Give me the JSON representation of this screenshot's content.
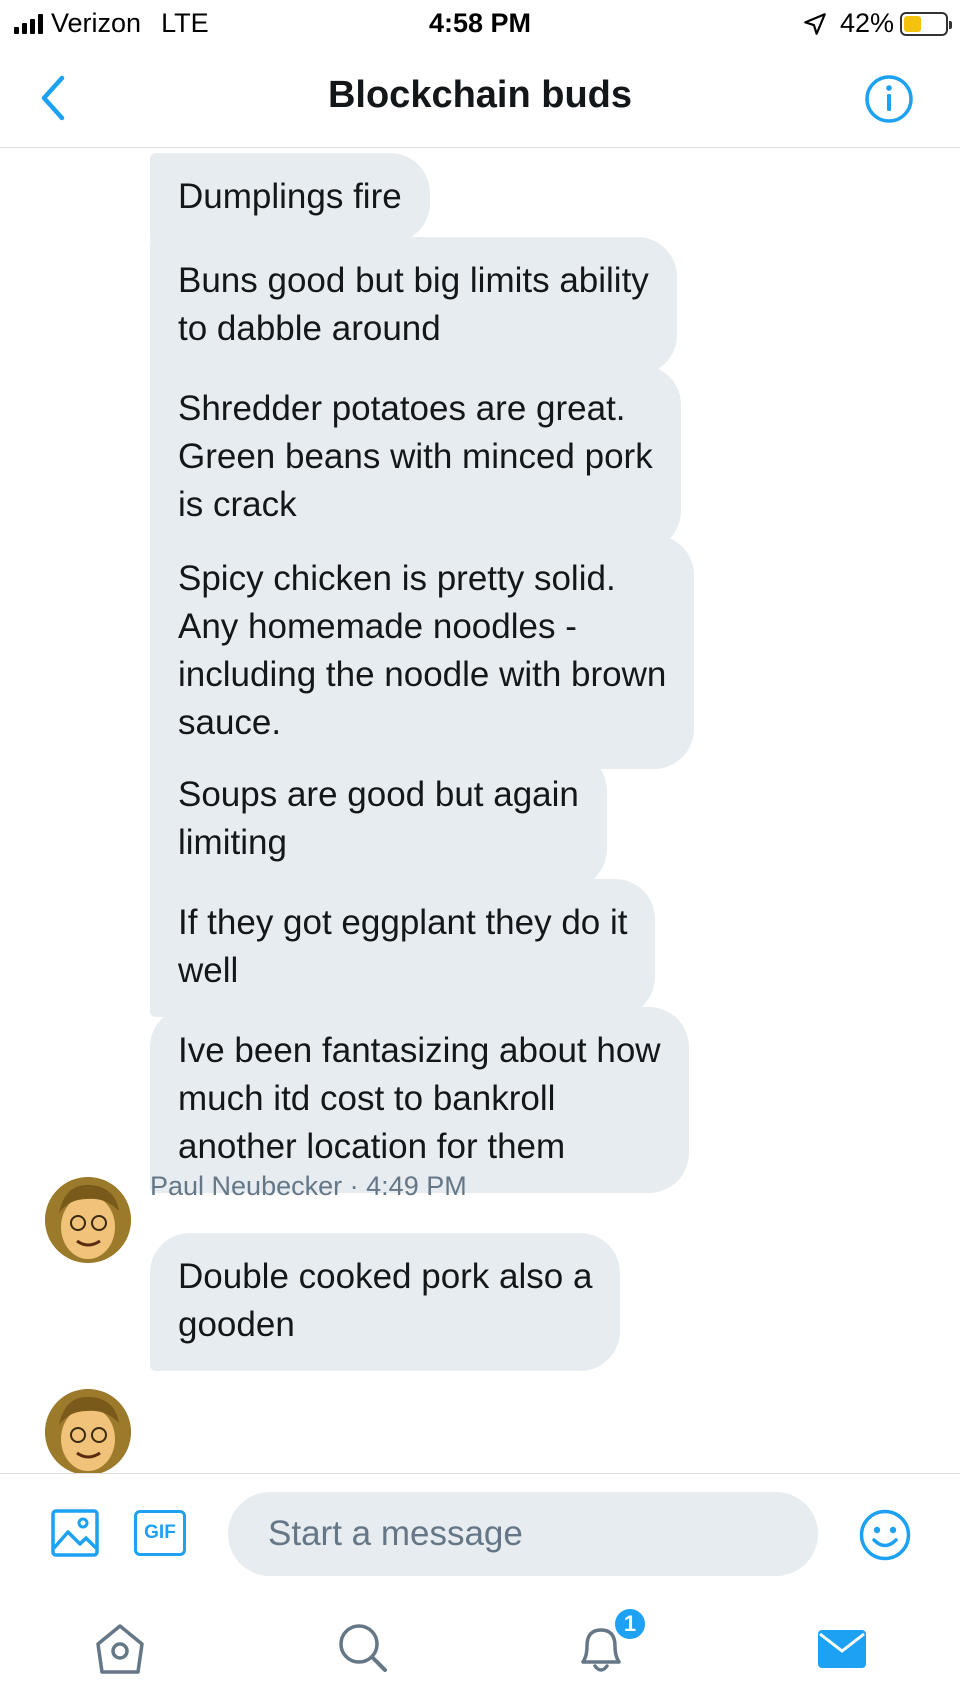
{
  "status_bar": {
    "carrier": "Verizon",
    "network": "LTE",
    "time": "4:58 PM",
    "battery": "42%",
    "battery_level": 0.42,
    "battery_color": "#f4c20d"
  },
  "header": {
    "title": "Blockchain buds",
    "back_icon": "chevron-left-icon",
    "info_icon": "info-icon"
  },
  "messages": [
    {
      "text": "Dumplings fire"
    },
    {
      "text": "Buns good but big limits ability\nto dabble around"
    },
    {
      "text": "Shredder potatoes are great.\nGreen beans with minced pork\nis crack"
    },
    {
      "text": "Spicy chicken is pretty solid.\nAny homemade noodles -\nincluding the noodle with brown\nsauce."
    },
    {
      "text": "Soups are good but again\nlimiting"
    },
    {
      "text": "If they got eggplant they do it\nwell"
    },
    {
      "text": "Ive been fantasizing about how\nmuch itd cost to bankroll\nanother location for them"
    },
    {
      "text": "Double cooked pork also a\ngooden"
    }
  ],
  "group_meta": {
    "sender": "Paul Neubecker",
    "separator": "·",
    "time": "4:49 PM"
  },
  "composer": {
    "placeholder": "Start a message",
    "gif_label": "GIF"
  },
  "tabbar": {
    "notification_count": "1"
  },
  "colors": {
    "accent": "#1da1f2",
    "bubble": "#e6ecf0",
    "meta_text": "#657786"
  }
}
